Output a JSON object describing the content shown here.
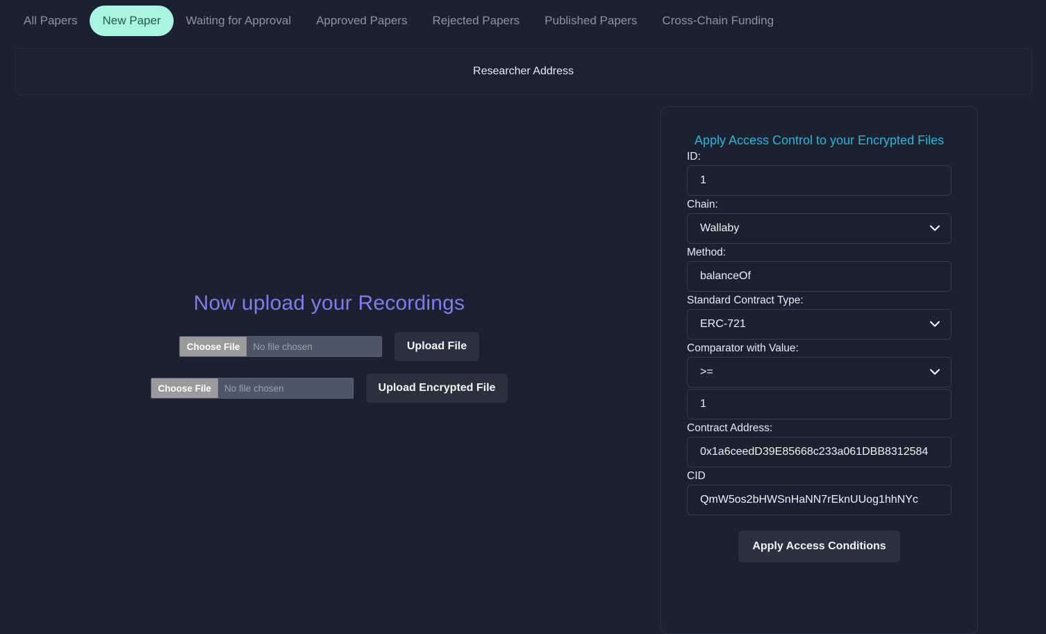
{
  "tabs": [
    {
      "label": "All Papers",
      "active": false
    },
    {
      "label": "New Paper",
      "active": true
    },
    {
      "label": "Waiting for Approval",
      "active": false
    },
    {
      "label": "Approved Papers",
      "active": false
    },
    {
      "label": "Rejected Papers",
      "active": false
    },
    {
      "label": "Published Papers",
      "active": false
    },
    {
      "label": "Cross-Chain Funding",
      "active": false
    }
  ],
  "address_bar": {
    "label": "Researcher Address"
  },
  "upload": {
    "title": "Now upload your Recordings",
    "rows": [
      {
        "choose_label": "Choose File",
        "file_name": "No file chosen",
        "button_label": "Upload File"
      },
      {
        "choose_label": "Choose File",
        "file_name": "No file chosen",
        "button_label": "Upload Encrypted File"
      }
    ]
  },
  "access_panel": {
    "title": "Apply Access Control to your Encrypted Files",
    "fields": {
      "id": {
        "label": "ID:",
        "value": "1"
      },
      "chain": {
        "label": "Chain:",
        "value": "Wallaby"
      },
      "method": {
        "label": "Method:",
        "value": "balanceOf"
      },
      "contract_type": {
        "label": "Standard Contract Type:",
        "value": "ERC-721"
      },
      "comparator": {
        "label": "Comparator with Value:",
        "value": ">="
      },
      "comparator_value": {
        "value": "1"
      },
      "contract_address": {
        "label": "Contract Address:",
        "value": "0x1a6ceedD39E85668c233a061DBB8312584"
      },
      "cid": {
        "label": "CID",
        "value": "QmW5os2bHWSnHaNN7rEknUUog1hhNYc"
      }
    },
    "submit_label": "Apply Access Conditions"
  },
  "colors": {
    "page_background": "#1b2130",
    "active_tab_background": "#aaf5e0",
    "active_tab_text": "#1f5a50",
    "inactive_tab_text": "#8c93a1",
    "upload_title": "#7d7ded",
    "panel_title": "#29b6d8",
    "button_background": "#2a303d"
  }
}
